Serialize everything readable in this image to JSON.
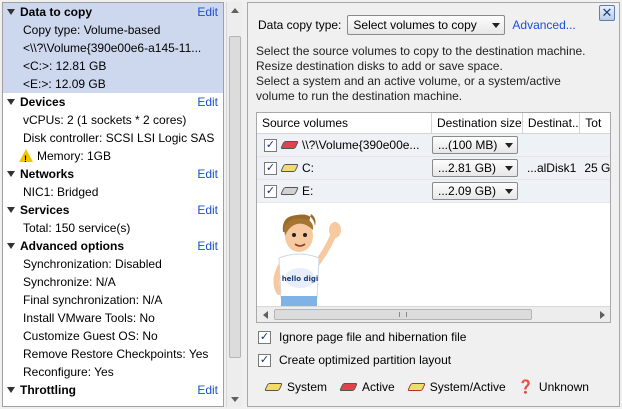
{
  "summary": {
    "edit_label": "Edit",
    "sections": [
      {
        "title": "Data to copy",
        "selected": true,
        "lines": [
          "Copy type: Volume-based",
          "<\\\\?\\Volume{390e00e6-a145-11...",
          "<C:>: 12.81 GB",
          "<E:>: 12.09 GB"
        ]
      },
      {
        "title": "Devices",
        "lines": [
          "vCPUs: 2 (1 sockets * 2 cores)",
          "Disk controller: SCSI LSI Logic SAS",
          "Memory: 1GB"
        ]
      },
      {
        "title": "Networks",
        "lines": [
          "NIC1: Bridged"
        ]
      },
      {
        "title": "Services",
        "lines": [
          "Total: 150 service(s)"
        ]
      },
      {
        "title": "Advanced options",
        "lines": [
          "Synchronization: Disabled",
          "Synchronize: N/A",
          "Final synchronization: N/A",
          "Install VMware Tools: No",
          "Customize Guest OS: No",
          "Remove Restore Checkpoints: Yes",
          "Reconfigure: Yes"
        ]
      },
      {
        "title": "Throttling",
        "lines": []
      }
    ]
  },
  "copy_type": {
    "label": "Data copy type:",
    "selected": "Select volumes to copy",
    "advanced_link": "Advanced..."
  },
  "instructions": [
    "Select the source volumes to copy to the destination machine.",
    "Resize destination disks to add or save space.",
    "Select a system and an active volume, or a system/active",
    "volume to run the destination machine."
  ],
  "volume_table": {
    "columns": [
      "Source volumes",
      "Destination size",
      "Destinat...",
      "Tot"
    ],
    "rows": [
      {
        "checked": true,
        "type": "red",
        "name": "\\\\?\\Volume{390e00e...",
        "size": "...(100 MB)",
        "dest": "",
        "total": ""
      },
      {
        "checked": true,
        "type": "yellow",
        "name": "C:",
        "size": "...2.81 GB)",
        "dest": "...alDisk1",
        "total": "25 G"
      },
      {
        "checked": true,
        "type": "gray",
        "name": "E:",
        "size": "...2.09 GB)",
        "dest": "",
        "total": ""
      }
    ]
  },
  "mascot": {
    "shirt_text": "hello digi"
  },
  "options": [
    {
      "checked": true,
      "label": "Ignore page file and hibernation file"
    },
    {
      "checked": true,
      "label": "Create optimized partition layout"
    }
  ],
  "legend": {
    "system": "System",
    "active": "Active",
    "system_active": "System/Active",
    "unknown": "Unknown"
  },
  "colors": {
    "link": "#1a4fd8",
    "selected_bg": "#cdd8ee",
    "active": "#e2434b",
    "system": "#f1dc6b"
  }
}
